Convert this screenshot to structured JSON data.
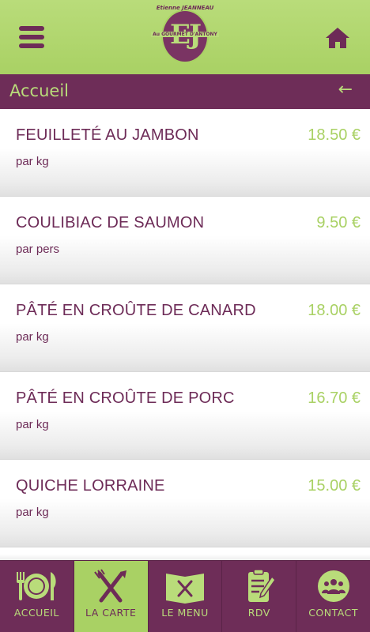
{
  "header": {
    "menu_icon": "hamburger-icon",
    "home_icon": "home-icon",
    "logo": {
      "top_text": "Etienne JEANNEAU",
      "middle_text": "Au GOURMET D'ANTONY",
      "letters": "EJ"
    }
  },
  "titlebar": {
    "title": "Accueil",
    "back_icon": "←"
  },
  "products": [
    {
      "name": "FEUILLETÉ AU JAMBON",
      "unit": "par kg",
      "price": "18.50 €"
    },
    {
      "name": "COULIBIAC DE SAUMON",
      "unit": "par pers",
      "price": "9.50 €"
    },
    {
      "name": "PÂTÉ EN CROÛTE DE CANARD",
      "unit": "par kg",
      "price": "18.00 €"
    },
    {
      "name": "PÂTÉ EN CROÛTE DE PORC",
      "unit": "par kg",
      "price": "16.70 €"
    },
    {
      "name": "QUICHE LORRAINE",
      "unit": "par kg",
      "price": "15.00 €"
    }
  ],
  "tabs": [
    {
      "label": "ACCUEIL",
      "icon": "plate-cutlery-icon",
      "active": false
    },
    {
      "label": "LA CARTE",
      "icon": "fork-knife-icon",
      "active": true
    },
    {
      "label": "LE MENU",
      "icon": "menu-book-icon",
      "active": false
    },
    {
      "label": "RDV",
      "icon": "clipboard-icon",
      "active": false
    },
    {
      "label": "CONTACT",
      "icon": "people-icon",
      "active": false
    }
  ],
  "colors": {
    "brand_green": "#a9d164",
    "brand_purple": "#6e2d58"
  }
}
